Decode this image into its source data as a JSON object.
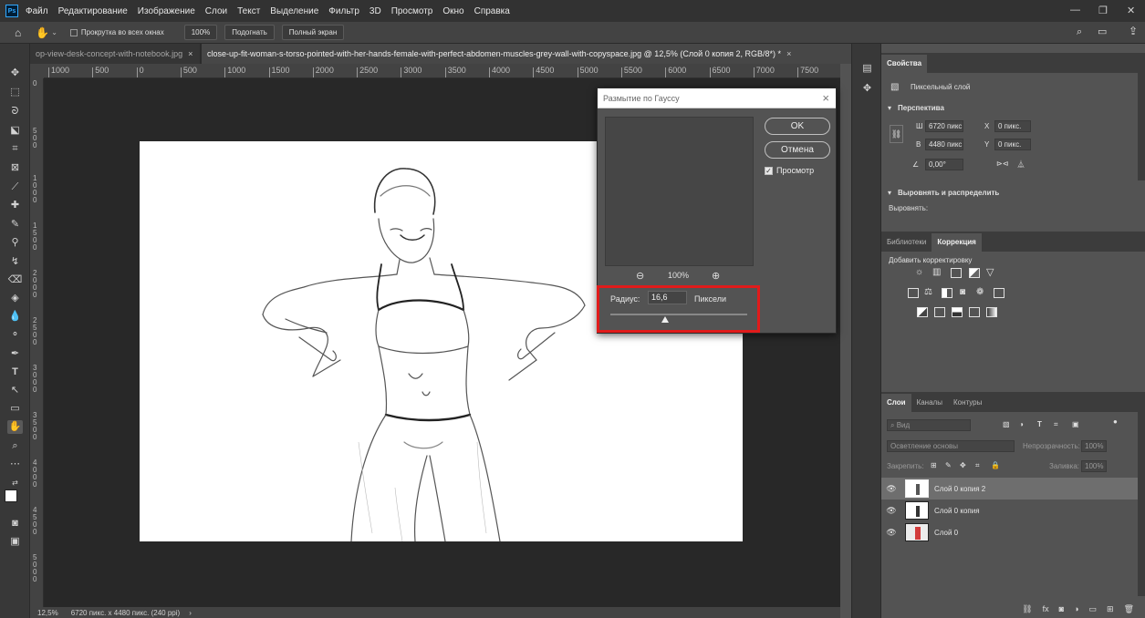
{
  "menubar": {
    "items": [
      "Файл",
      "Редактирование",
      "Изображение",
      "Слои",
      "Текст",
      "Выделение",
      "Фильтр",
      "3D",
      "Просмотр",
      "Окно",
      "Справка"
    ]
  },
  "options": {
    "scroll_all": "Прокрутка во всех окнах",
    "zoom100": "100%",
    "fit": "Подогнать",
    "fullscreen": "Полный экран"
  },
  "tabs": [
    {
      "label": "op-view-desk-concept-with-notebook.jpg",
      "active": false
    },
    {
      "label": "close-up-fit-woman-s-torso-pointed-with-her-hands-female-with-perfect-abdomen-muscles-grey-wall-with-copyspace.jpg @ 12,5% (Слой 0 копия 2, RGB/8*) *",
      "active": true
    }
  ],
  "ruler_h": [
    "1000",
    "500",
    "0",
    "500",
    "1000",
    "1500",
    "2000",
    "2500",
    "3000",
    "3500",
    "4000",
    "4500",
    "5000",
    "5500",
    "6000",
    "6500",
    "7000",
    "7500"
  ],
  "ruler_v": [
    "0",
    "5 0 0",
    "1 0 0 0",
    "1 5 0 0",
    "2 0 0 0",
    "2 5 0 0",
    "3 0 0 0",
    "3 5 0 0",
    "4 0 0 0",
    "4 5 0 0",
    "5 0 0 0"
  ],
  "status": {
    "zoom": "12,5%",
    "doc_info": "6720 пикс. x 4480 пикс. (240 ppi)"
  },
  "dialog": {
    "title": "Размытие по Гауссу",
    "ok": "OK",
    "cancel": "Отмена",
    "preview_label": "Просмотр",
    "preview_checked": true,
    "zoom": "100%",
    "radius_label": "Радиус:",
    "radius_value": "16,6",
    "radius_units": "Пиксели",
    "radius_slider_fraction": 0.4
  },
  "properties": {
    "tab": "Свойства",
    "layer_type": "Пиксельный слой",
    "section_transform": "Перспектива",
    "w_label": "Ш",
    "w_value": "6720 пикс",
    "h_label": "В",
    "h_value": "4480 пикс",
    "x_label": "X",
    "x_value": "0 пикс.",
    "y_label": "Y",
    "y_value": "0 пикс.",
    "angle_value": "0,00°",
    "section_align": "Выровнять и распределить",
    "align_label": "Выровнять:"
  },
  "adjustments": {
    "tabs": [
      "Библиотеки",
      "Коррекция"
    ],
    "active_tab": "Коррекция",
    "add_label": "Добавить корректировку"
  },
  "layers": {
    "tabs": [
      "Слои",
      "Каналы",
      "Контуры"
    ],
    "active_tab": "Слои",
    "search_placeholder": "Вид",
    "blend_mode": "Осветление основы",
    "opacity_label": "Непрозрачность:",
    "opacity_value": "100%",
    "lock_label": "Закрепить:",
    "fill_label": "Заливка:",
    "fill_value": "100%",
    "items": [
      {
        "name": "Слой 0 копия 2",
        "selected": true
      },
      {
        "name": "Слой 0 копия",
        "selected": false
      },
      {
        "name": "Слой 0",
        "selected": false
      }
    ]
  },
  "colors": {
    "highlight": "#e11b1b",
    "accent": "#31a8ff"
  }
}
